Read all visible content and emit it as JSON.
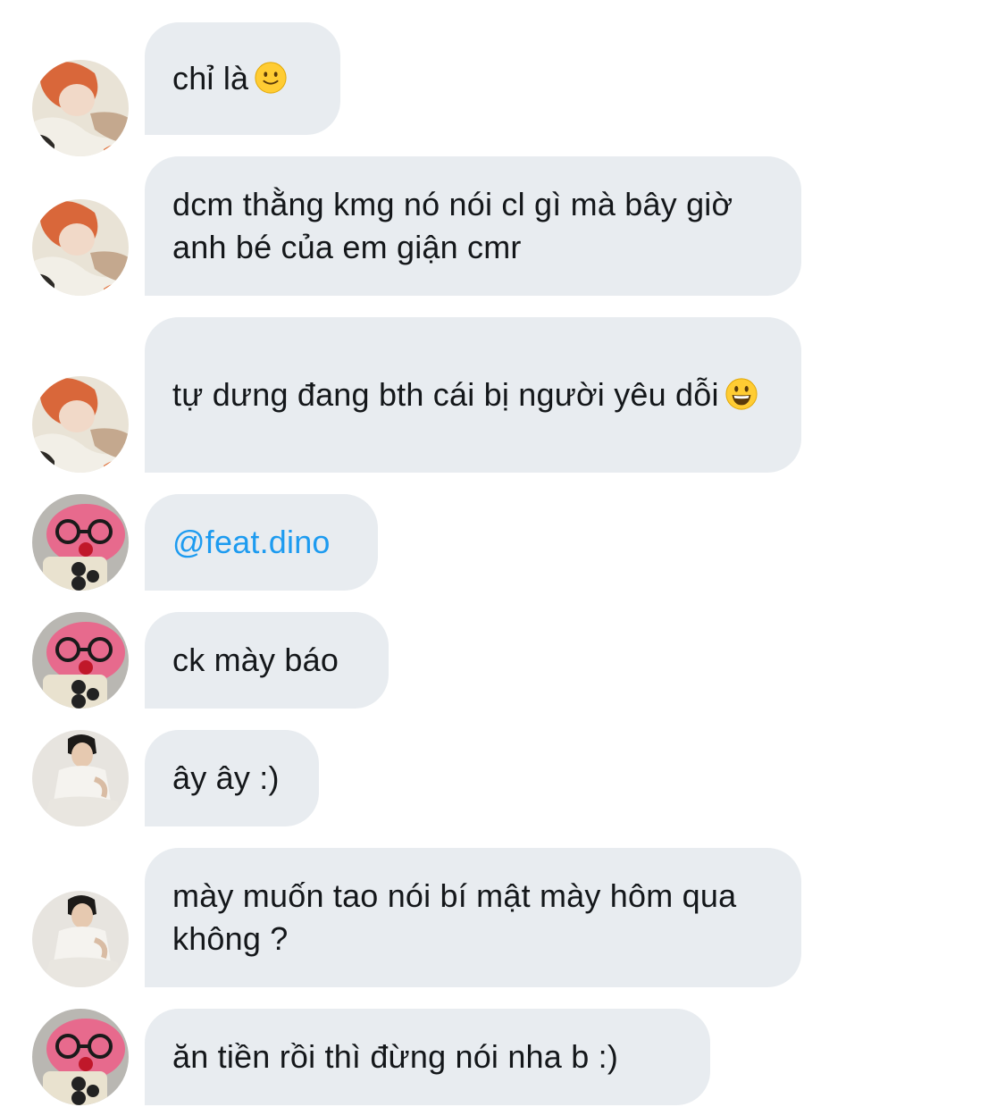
{
  "messages": [
    {
      "avatar": "avatar-redhair",
      "text": "chỉ là",
      "emoji": "slightly-smiling-face-icon"
    },
    {
      "avatar": "avatar-redhair",
      "text": "dcm thằng kmg nó nói cl gì mà bây giờ anh bé của em giận cmr"
    },
    {
      "avatar": "avatar-redhair",
      "text": "tự dưng đang bth cái bị người yêu dỗi",
      "emoji": "grinning-face-icon"
    },
    {
      "avatar": "avatar-pink-plush",
      "text": "@feat.dino",
      "is_mention": true
    },
    {
      "avatar": "avatar-pink-plush",
      "text": "ck mày báo"
    },
    {
      "avatar": "avatar-man-white",
      "text": "ây ây :)"
    },
    {
      "avatar": "avatar-man-white",
      "text": "mày muốn tao nói bí mật mày hôm qua không ?"
    },
    {
      "avatar": "avatar-pink-plush",
      "text": "ăn tiền rồi thì đừng nói nha b :)"
    }
  ],
  "colors": {
    "bubble": "#e8ecf0",
    "text": "#14171a",
    "mention": "#1d9bf0",
    "background": "#ffffff"
  }
}
